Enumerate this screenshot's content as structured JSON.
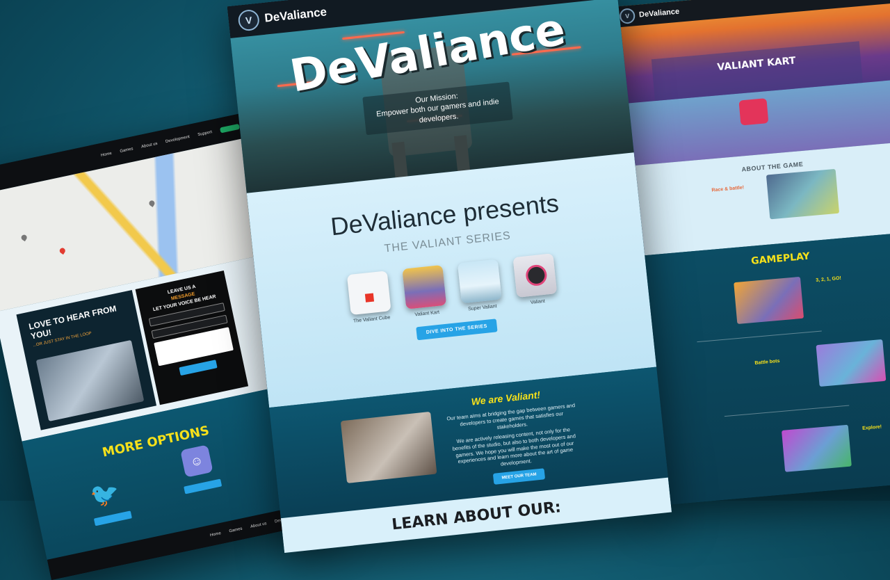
{
  "center": {
    "brand": "DeValiance",
    "hero_title": "DeValiance",
    "mission_label": "Our Mission:",
    "mission_text": "Empower both our gamers and indie developers.",
    "presents_title": "DeValiance presents",
    "series_title": "THE VALIANT SERIES",
    "games": [
      {
        "name": "The Valiant Cube"
      },
      {
        "name": "Valiant Kart"
      },
      {
        "name": "Super Valiant"
      },
      {
        "name": "Valiant"
      }
    ],
    "series_button": "DIVE INTO THE SERIES",
    "valiant_heading": "We are Valiant!",
    "valiant_p1": "Our team aims at bridging the gap between gamers and developers to create games that satisfies our stakeholders.",
    "valiant_p2": "We are actively releasing content, not only for the benefits of the studio, but also to both developers and gamers. We hope you will make the most out of our experiences and learn more about the art of game development.",
    "team_button": "MEET OUR TEAM",
    "learn_heading": "LEARN ABOUT OUR:"
  },
  "left": {
    "nav": [
      "Home",
      "Games",
      "About us",
      "Development",
      "Support"
    ],
    "contact_heading": "LOVE TO HEAR FROM YOU!",
    "contact_sub": "...OR JUST STAY IN THE LOOP",
    "form_title_1": "LEAVE US A",
    "form_title_2": "MESSAGE",
    "form_title_3": "LET YOUR VOICE BE HEAR",
    "more_heading": "MORE OPTIONS"
  },
  "right": {
    "brand": "DeValiance",
    "hero_title": "VALIANT KART",
    "about_heading": "ABOUT THE GAME",
    "about_feature": "Race & battle!",
    "gameplay_heading": "GAMEPLAY",
    "gp1": "3, 2, 1, GO!",
    "gp2": "Battle bots",
    "gp3": "Explore!"
  }
}
